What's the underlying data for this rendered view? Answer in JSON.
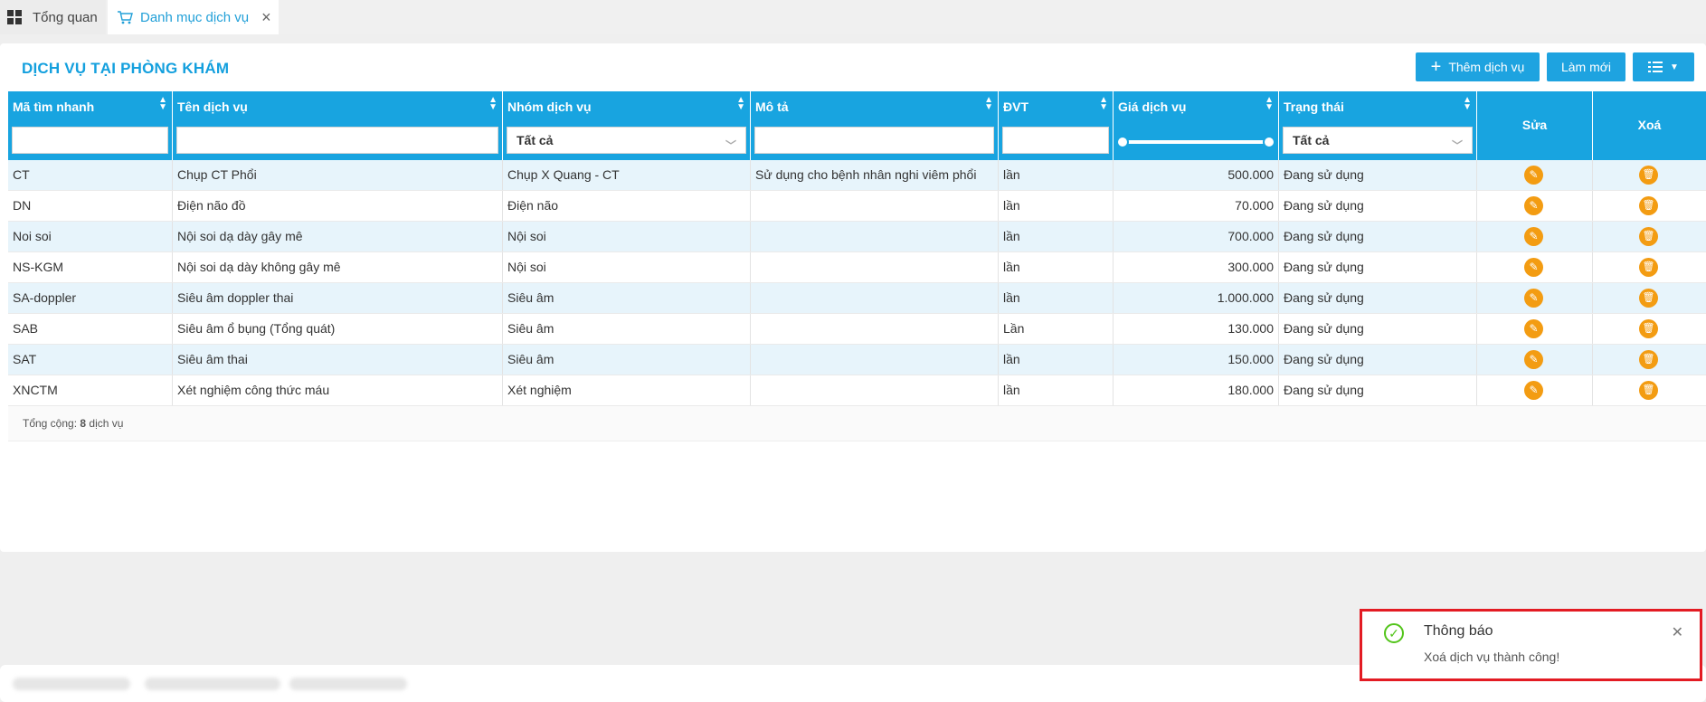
{
  "tabs": [
    {
      "label": "Tổng quan"
    },
    {
      "label": "Danh mục dịch vụ"
    }
  ],
  "page": {
    "title": "DỊCH VỤ TẠI PHÒNG KHÁM",
    "add_button": "Thêm dịch vụ",
    "refresh_button": "Làm mới"
  },
  "table": {
    "columns": [
      "Mã tìm nhanh",
      "Tên dịch vụ",
      "Nhóm dịch vụ",
      "Mô tả",
      "ĐVT",
      "Giá dịch vụ",
      "Trạng thái",
      "Sửa",
      "Xoá"
    ],
    "filters": {
      "group": "Tất cả",
      "status": "Tất cả"
    },
    "rows": [
      {
        "code": "CT",
        "name": "Chụp CT Phổi",
        "group": "Chụp X Quang - CT",
        "desc": "Sử dụng cho bệnh nhân nghi viêm phổi",
        "unit": "lần",
        "price": "500.000",
        "status": "Đang sử dụng"
      },
      {
        "code": "DN",
        "name": "Điện não đồ",
        "group": "Điện não",
        "desc": "",
        "unit": "lần",
        "price": "70.000",
        "status": "Đang sử dụng"
      },
      {
        "code": "Noi soi",
        "name": "Nội soi dạ dày gây mê",
        "group": "Nội soi",
        "desc": "",
        "unit": "lần",
        "price": "700.000",
        "status": "Đang sử dụng"
      },
      {
        "code": "NS-KGM",
        "name": "Nội soi dạ dày không gây mê",
        "group": "Nội soi",
        "desc": "",
        "unit": "lần",
        "price": "300.000",
        "status": "Đang sử dụng"
      },
      {
        "code": "SA-doppler",
        "name": "Siêu âm doppler thai",
        "group": "Siêu âm",
        "desc": "",
        "unit": "lần",
        "price": "1.000.000",
        "status": "Đang sử dụng"
      },
      {
        "code": "SAB",
        "name": "Siêu âm ổ bụng (Tổng quát)",
        "group": "Siêu âm",
        "desc": "",
        "unit": "Lần",
        "price": "130.000",
        "status": "Đang sử dụng"
      },
      {
        "code": "SAT",
        "name": "Siêu âm thai",
        "group": "Siêu âm",
        "desc": "",
        "unit": "lần",
        "price": "150.000",
        "status": "Đang sử dụng"
      },
      {
        "code": "XNCTM",
        "name": "Xét nghiệm công thức máu",
        "group": "Xét nghiệm",
        "desc": "",
        "unit": "lần",
        "price": "180.000",
        "status": "Đang sử dụng"
      }
    ],
    "footer": {
      "prefix": "Tổng cộng:",
      "count": "8",
      "suffix": "dịch vụ"
    }
  },
  "toast": {
    "title": "Thông báo",
    "message": "Xoá dịch vụ thành công!"
  },
  "colors": {
    "accent": "#18a4e0",
    "action": "#f39c12",
    "success": "#52c41a",
    "highlight": "#e31b23"
  }
}
